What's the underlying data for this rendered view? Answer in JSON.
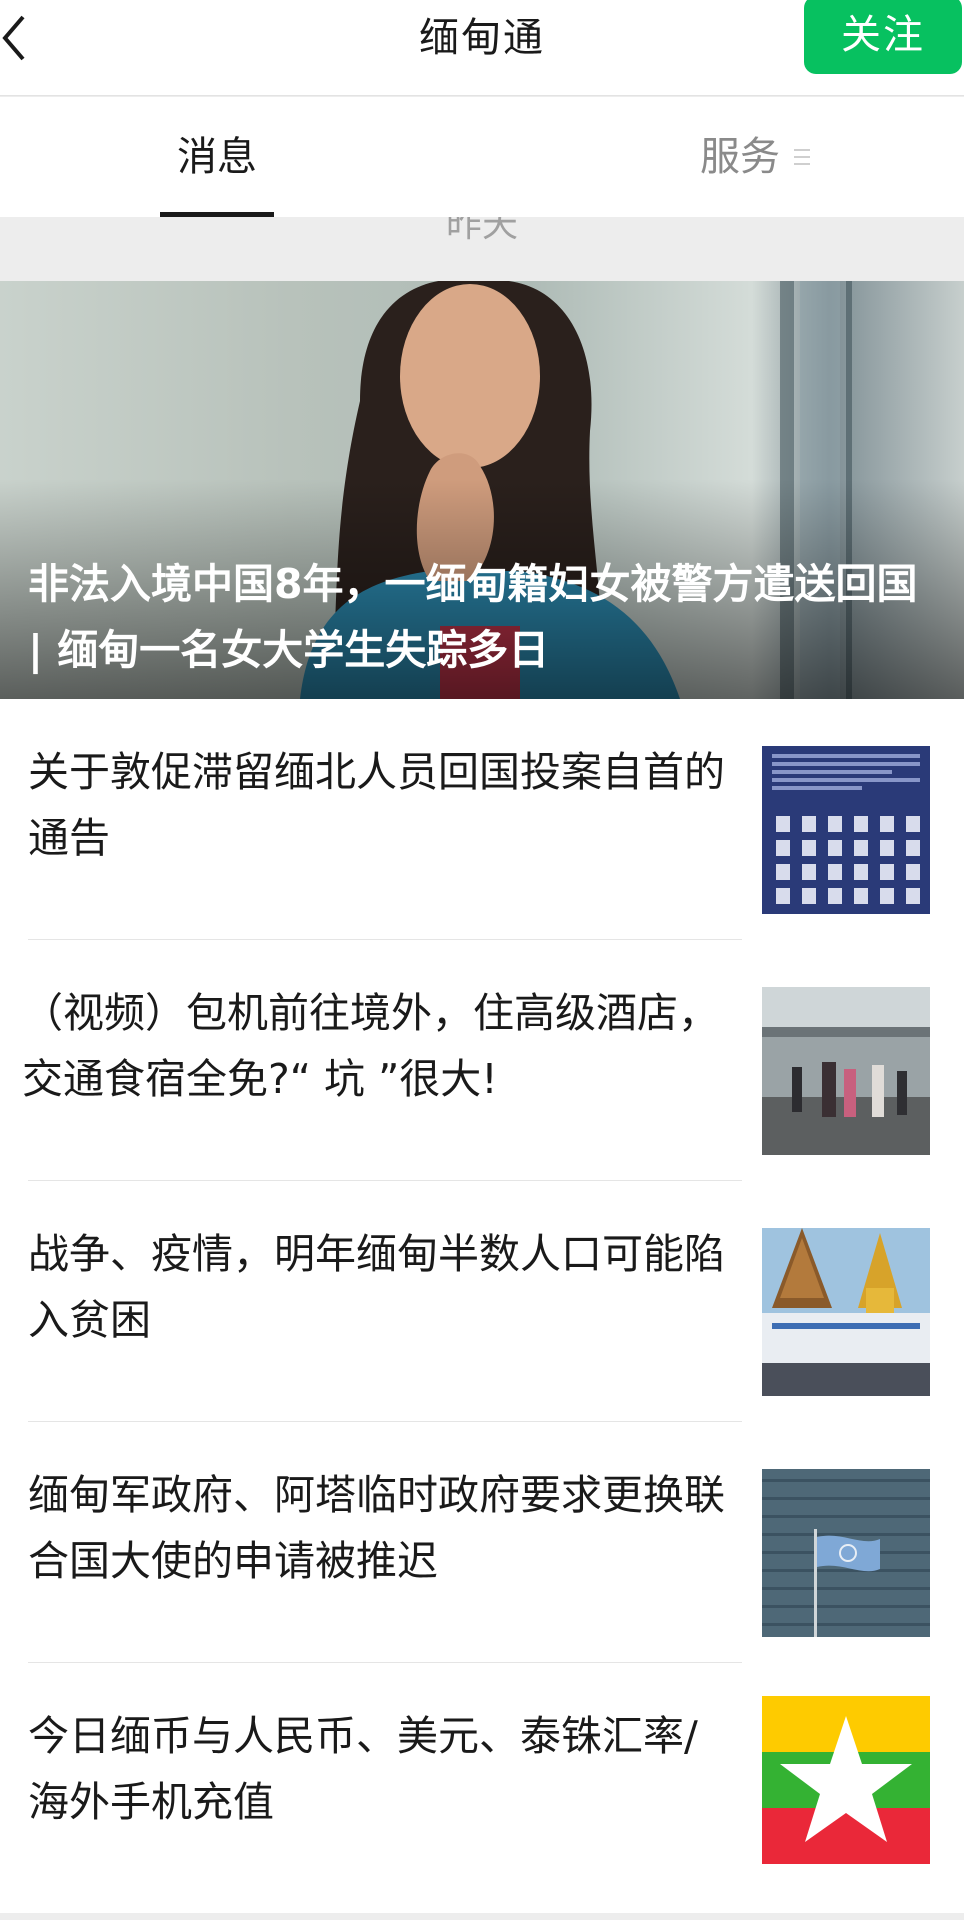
{
  "header": {
    "title": "缅甸通",
    "follow_label": "关注",
    "back_icon": "chevron-left-icon"
  },
  "tabs": [
    {
      "label": "消息",
      "active": true
    },
    {
      "label": "服务",
      "active": false,
      "icon": "menu-icon"
    }
  ],
  "date_label": "昨天",
  "hero": {
    "title": "非法入境中国8年，一缅甸籍妇女被警方遣送回国 | 缅甸一名女大学生失踪多日"
  },
  "articles": [
    {
      "title": "关于敦促滞留缅北人员回国投案自首的通告",
      "thumb": "notice-document"
    },
    {
      "title": "（视频）包机前往境外，住高级酒店，交通食宿全免?“ 坑 ”很大!",
      "thumb": "airport-crowd"
    },
    {
      "title": "战争、疫情，明年缅甸半数人口可能陷入贫困",
      "thumb": "golden-pagoda"
    },
    {
      "title": "缅甸军政府、阿塔临时政府要求更换联合国大使的申请被推迟",
      "thumb": "un-flag-building"
    },
    {
      "title": "今日缅币与人民币、美元、泰铢汇率/海外手机充值",
      "thumb": "myanmar-flag"
    }
  ],
  "colors": {
    "accent": "#07c160",
    "myanmar_yellow": "#fecb00",
    "myanmar_green": "#34b233",
    "myanmar_red": "#ea2839"
  }
}
